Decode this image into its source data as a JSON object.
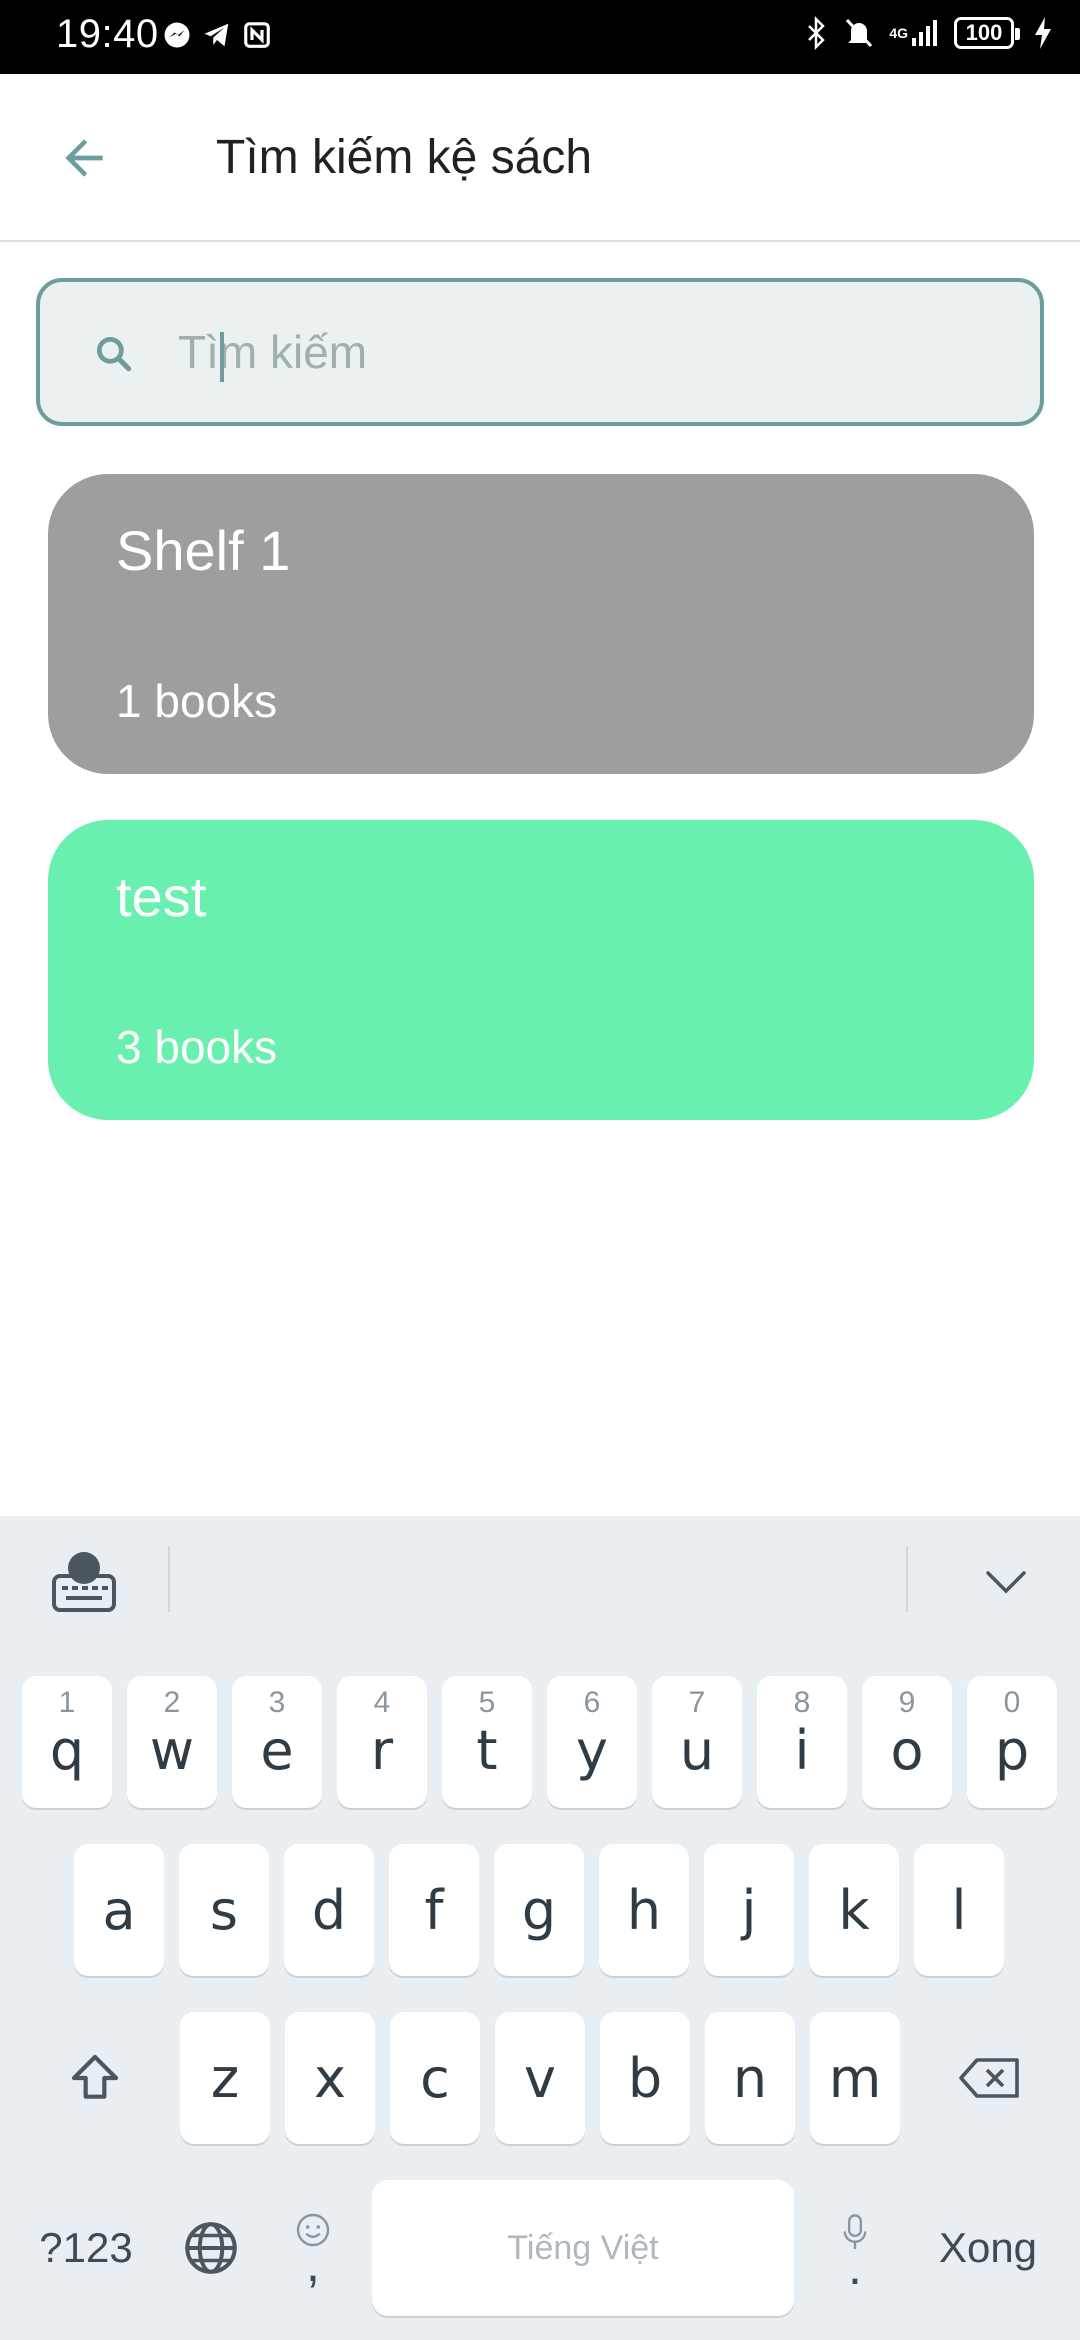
{
  "status_bar": {
    "time": "19:40",
    "battery": "100",
    "network": "4G"
  },
  "app_bar": {
    "title": "Tìm kiếm kệ sách"
  },
  "search": {
    "placeholder": "Tìm kiếm",
    "value": ""
  },
  "shelves": [
    {
      "name": "Shelf 1",
      "count": "1 books",
      "color": "#9e9e9e"
    },
    {
      "name": "test",
      "count": "3 books",
      "color": "#69f0ae"
    }
  ],
  "keyboard": {
    "row1": [
      {
        "key": "q",
        "hint": "1"
      },
      {
        "key": "w",
        "hint": "2"
      },
      {
        "key": "e",
        "hint": "3"
      },
      {
        "key": "r",
        "hint": "4"
      },
      {
        "key": "t",
        "hint": "5"
      },
      {
        "key": "y",
        "hint": "6"
      },
      {
        "key": "u",
        "hint": "7"
      },
      {
        "key": "i",
        "hint": "8"
      },
      {
        "key": "o",
        "hint": "9"
      },
      {
        "key": "p",
        "hint": "0"
      }
    ],
    "row2": [
      "a",
      "s",
      "d",
      "f",
      "g",
      "h",
      "j",
      "k",
      "l"
    ],
    "row3": [
      "z",
      "x",
      "c",
      "v",
      "b",
      "n",
      "m"
    ],
    "symbols_label": "?123",
    "comma": ",",
    "period": ".",
    "space_label": "Tiếng Việt",
    "done_label": "Xong"
  },
  "colors": {
    "accent": "#6d9d9c",
    "search_bg": "#eaf1f0"
  },
  "icons": {
    "back": "arrow-left-icon",
    "search": "search-icon",
    "keyboard_settings": "keyboard-globe-icon",
    "collapse": "chevron-down-icon",
    "shift": "shift-icon",
    "backspace": "backspace-icon",
    "globe": "globe-icon",
    "emoji": "emoji-icon",
    "mic": "mic-icon"
  }
}
